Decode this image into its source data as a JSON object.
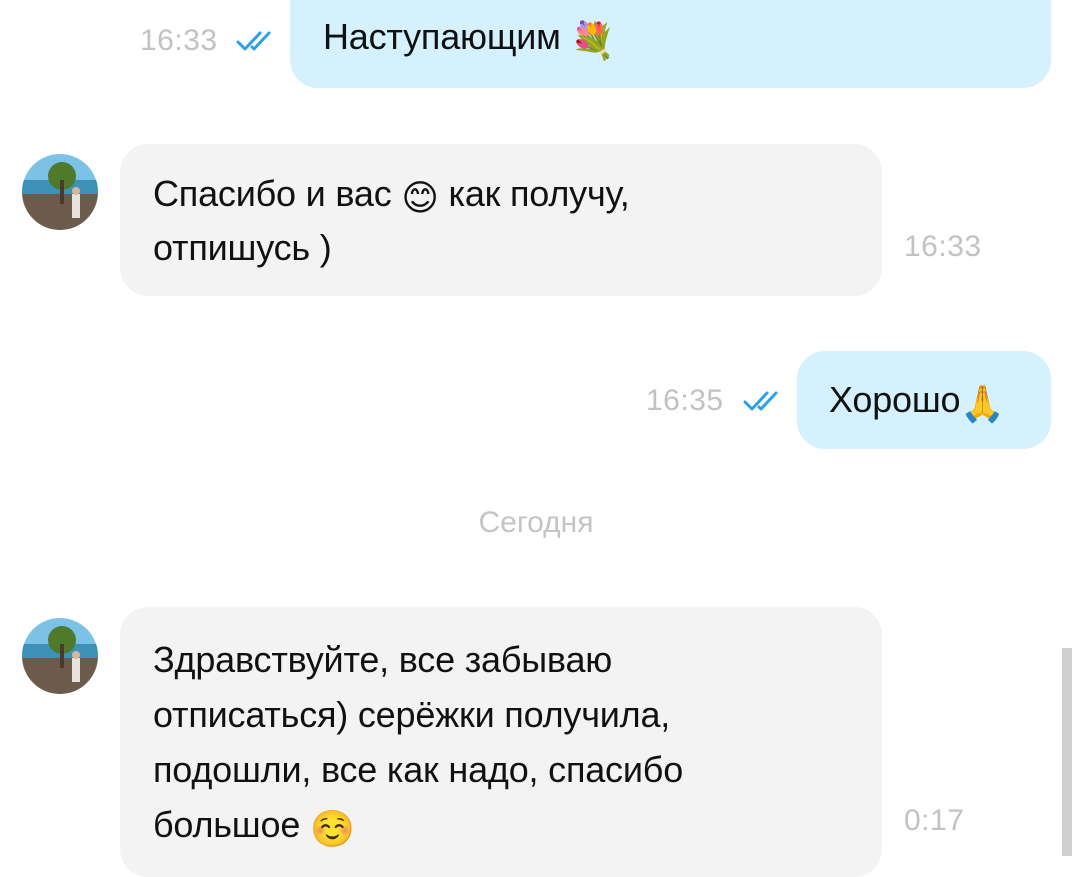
{
  "messages": [
    {
      "direction": "out",
      "text": "Наступающим",
      "emoji": "💐",
      "time": "16:33",
      "status": "read"
    },
    {
      "direction": "in",
      "line1": "Спасибо и вас",
      "emoji": "😊",
      "line1_after": "как получу,",
      "line2": "отпишусь )",
      "time": "16:33"
    },
    {
      "direction": "out",
      "text": "Хорошо",
      "emoji": "🙏",
      "time": "16:35",
      "status": "read"
    },
    {
      "direction": "in",
      "lines": [
        "Здравствуйте, все забываю",
        "отписаться) серёжки получила,",
        "подошли, все как надо, спасибо",
        "большое"
      ],
      "emoji": "☺️",
      "time": "0:17"
    }
  ],
  "date_separator": "Сегодня",
  "colors": {
    "outgoing_bubble": "#d4f1fd",
    "incoming_bubble": "#f3f3f3",
    "read_ticks": "#2aa1e8",
    "timestamp": "#c2c2c2"
  },
  "icons": {
    "read_status": "double-check-icon"
  }
}
